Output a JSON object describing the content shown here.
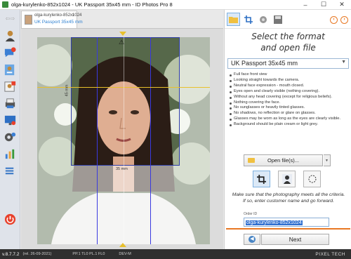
{
  "window": {
    "title": "olga-kurylenko-852x1024 - UK Passport 35x45 mm - ID Photos Pro 8",
    "minimize": "–",
    "maximize": "☐",
    "close": "✕"
  },
  "doc_tab": {
    "filename": "olga-kurylenko-852x1024",
    "format": "UK Passport 35x45 mm",
    "close": "x"
  },
  "canvas": {
    "width_label": "35 mm",
    "height_label": "45 mm"
  },
  "panel": {
    "heading_line1": "Select the format",
    "heading_line2": "and open file",
    "format_select": {
      "value": "UK Passport 35x45 mm"
    },
    "requirements": [
      "Full face front view",
      "Looking straight towards the camera.",
      "Neutral face expression - mouth closed.",
      "Eyes open and clearly visible (nothing covering).",
      "Without any head covering (except for religious beliefs).",
      "Nothing covering the face.",
      "No sunglasses or heavily tinted glasses.",
      "No shadows, no reflection or glare on glasses.",
      "Glasses may be worn as long as the eyes are clearly visible.",
      "Background should be plain cream or light grey."
    ],
    "open_button": "Open file(s)...",
    "note": "Make sure that the photography meets all the criteria. If so, enter customer name and go forward.",
    "order_label": "Order ID",
    "order_value": "olga-kurylenko-852x1024",
    "next_button": "Next"
  },
  "statusbar": {
    "version": "v.8.7.7.2",
    "build": "(rel. 26-09-2021)",
    "item1": "PP.1 TL0 PL.1 FL0",
    "item2": "DEV-M",
    "brand": "PIXEL TECH"
  },
  "colors": {
    "accent": "#e87722",
    "selection": "#2f6fd0",
    "power": "#e8412c"
  }
}
